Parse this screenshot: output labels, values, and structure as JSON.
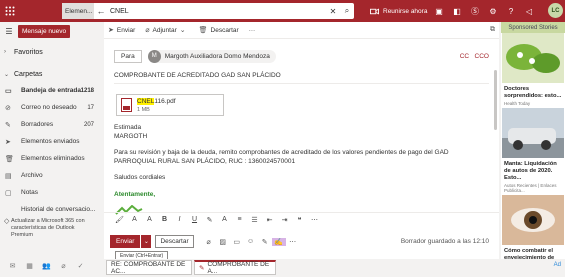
{
  "topbar": {
    "search_scope": "Elemen...",
    "search_text": "CNEL",
    "meet_now": "Reunirse ahora",
    "avatar_initials": "LC"
  },
  "leftnav": {
    "new_message": "Mensaje nuevo",
    "favorites": "Favoritos",
    "folders_header": "Carpetas",
    "folders": [
      {
        "label": "Bandeja de entrada",
        "count": "1218",
        "icon": "inbox-icon"
      },
      {
        "label": "Correo no deseado",
        "count": "17",
        "icon": "junk-icon"
      },
      {
        "label": "Borradores",
        "count": "207",
        "icon": "drafts-icon"
      },
      {
        "label": "Elementos enviados",
        "count": "",
        "icon": "sent-icon"
      },
      {
        "label": "Elementos eliminados",
        "count": "",
        "icon": "trash-icon"
      },
      {
        "label": "Archivo",
        "count": "",
        "icon": "archive-icon"
      },
      {
        "label": "Notas",
        "count": "",
        "icon": "notes-icon"
      },
      {
        "label": "Historial de conversacio...",
        "count": "",
        "icon": "history-icon"
      }
    ],
    "upgrade_text": "Actualizar a Microsoft 365 con características de Outlook Premium"
  },
  "compose": {
    "toolbar": {
      "send": "Enviar",
      "attach": "Adjuntar",
      "discard": "Descartar",
      "more": "···"
    },
    "to_label": "Para",
    "recipient_initial": "M",
    "recipient_name": "Margoth Auxiliadora Domo Mendoza",
    "cc": "CC",
    "bcc": "CCO",
    "subject": "COMPROBANTE DE ACREDITADO GAD SAN PLÁCIDO",
    "attachment": {
      "name_highlight": "CNEL",
      "name_rest": "116.pdf",
      "size": "1 MB"
    },
    "body": {
      "greeting": "Estimada",
      "name": "MARGOTH",
      "paragraph": "Para su revisión y baja de la deuda, remito comprobantes de acreditado de los valores pendientes de pago del GAD PARROQUIAL RURAL SAN PLÁCIDO, RUC : 1360024570001",
      "closing": "Saludos cordiales",
      "signature": "Atentamente,"
    },
    "send_button": "Enviar",
    "discard_button": "Descartar",
    "draft_status": "Borrador guardado a las 12:10",
    "tooltip": "Enviar (Ctrl+Entrar)"
  },
  "ads": {
    "header": "Sponsored Stories",
    "items": [
      {
        "title": "Doctores sorprendidos: esto...",
        "source": "Health Today"
      },
      {
        "title": "Manta: Liquidación de autos de 2020. Esto...",
        "source": "Autos Recientes | Enlaces Publicita..."
      },
      {
        "title": "Cómo combatir el envejecimiento de la...",
        "source": "Skin Care Daily"
      }
    ]
  },
  "bottom": {
    "tab1": "RE: COMPROBANTE DE AC...",
    "tab2": "COMPROBANTE DE A...",
    "ad_tag": "Ad"
  },
  "colors": {
    "brand": "#a4262c",
    "ad_header": "#c8d8a0",
    "highlight": "#fff100"
  }
}
